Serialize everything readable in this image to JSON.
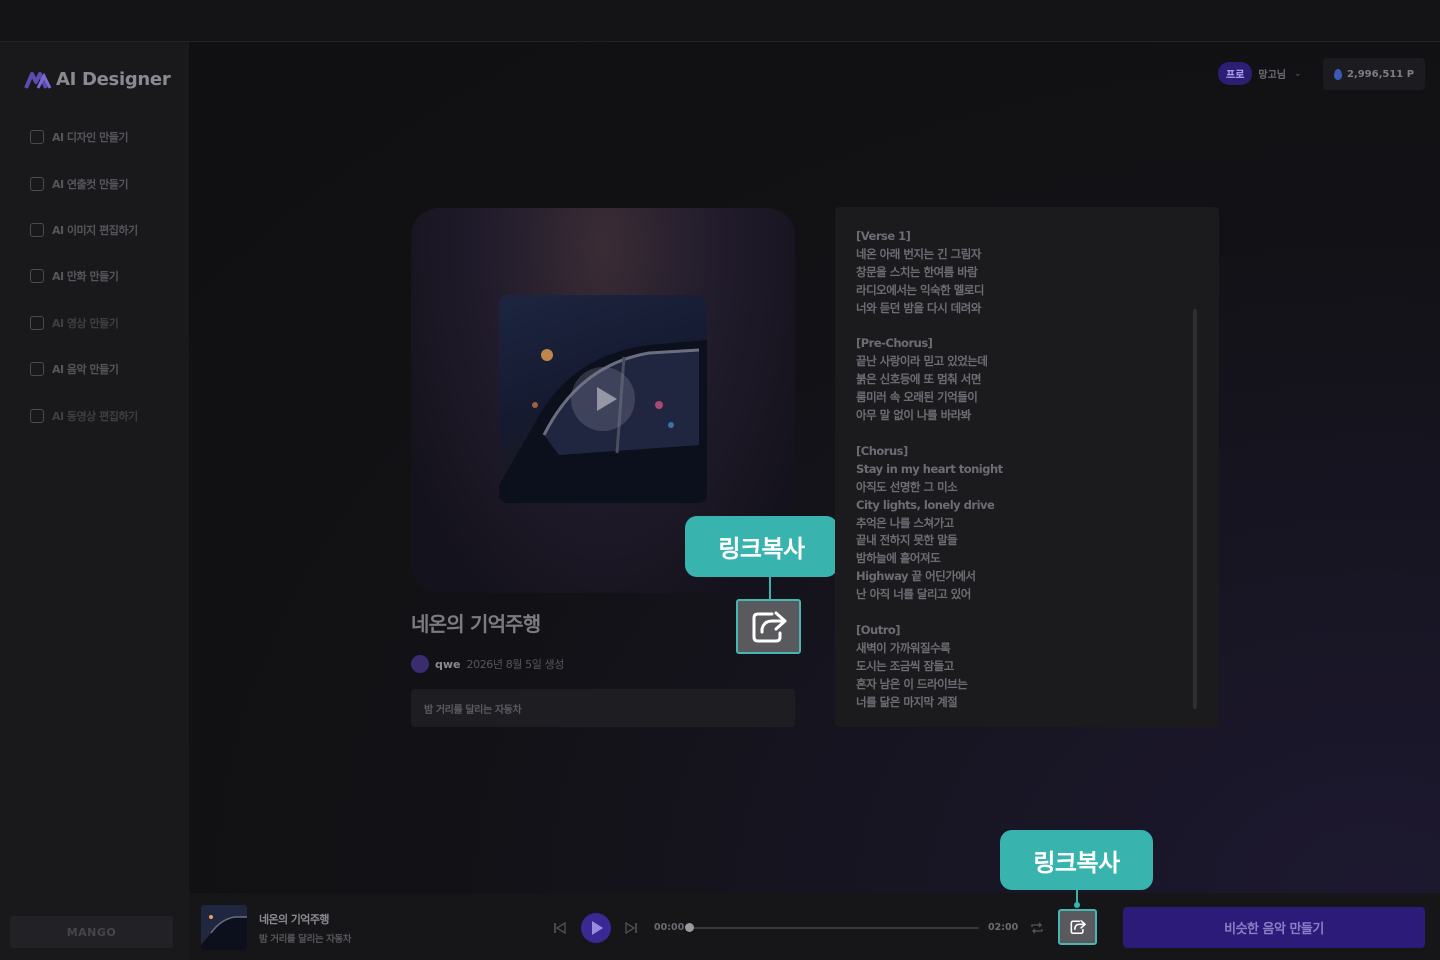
{
  "app": {
    "name": "AI Designer",
    "brand_footer": "MANGO"
  },
  "sidebar": {
    "items": [
      {
        "label": "AI 디자인 만들기",
        "icon": "edit-icon"
      },
      {
        "label": "AI 연출컷 만들기",
        "icon": "add-image-icon"
      },
      {
        "label": "AI 이미지 편집하기",
        "icon": "image-edit-icon"
      },
      {
        "label": "AI 만화 만들기",
        "icon": "comic-icon"
      },
      {
        "label": "AI 영상 만들기",
        "icon": "video-icon"
      },
      {
        "label": "AI 음악 만들기",
        "icon": "music-icon"
      },
      {
        "label": "AI 동영상 편집하기",
        "icon": "video-edit-icon"
      }
    ]
  },
  "header": {
    "badge": "프로",
    "user": "망고님",
    "points": "2,996,511 P"
  },
  "song": {
    "title": "네온의 기억주행",
    "author": "qwe",
    "date": "2026년 8월 5일 생성",
    "description": "밤 거리를 달리는 자동차"
  },
  "lyrics": "[Verse 1]\n네온 아래 번지는 긴 그림자\n창문을 스치는 한여름 바람\n라디오에서는 익숙한 멜로디\n너와 듣던 밤을 다시 데려와\n\n[Pre-Chorus]\n끝난 사랑이라 믿고 있었는데\n붉은 신호등에 또 멈춰 서면\n룸미러 속 오래된 기억들이\n아무 말 없이 나를 바라봐\n\n[Chorus]\nStay in my heart tonight\n아직도 선명한 그 미소\nCity lights, lonely drive\n추억은 나를 스쳐가고\n끝내 전하지 못한 말들\n밤하늘에 흩어져도\nHighway 끝 어딘가에서\n난 아직 너를 달리고 있어\n\n[Outro]\n새벽이 가까워질수록\n도시는 조금씩 잠들고\n혼자 남은 이 드라이브는\n너를 닮은 마지막 계절",
  "tooltips": {
    "share_main": "링크복사",
    "share_player": "링크복사"
  },
  "player": {
    "title": "네온의 기억주행",
    "subtitle": "밤 거리를 달리는 자동차",
    "current_time": "00:00",
    "end_time": "02:00",
    "progress": 0,
    "similar_button": "비슷한 음악 만들기"
  },
  "colors": {
    "accent": "#39b3ae",
    "brand_purple": "#2c1b78",
    "background": "#101012"
  }
}
